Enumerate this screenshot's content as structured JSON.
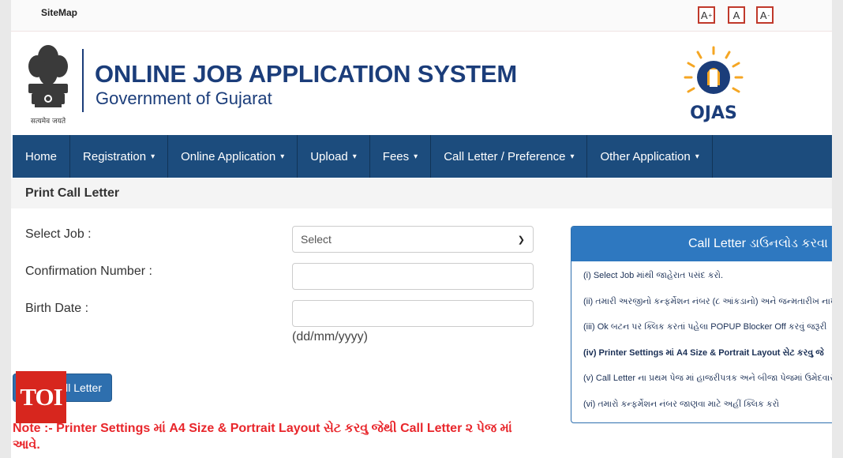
{
  "topbar": {
    "sitemap_label": "SiteMap",
    "font_increase": "A",
    "font_increase_sup": "+",
    "font_normal": "A",
    "font_decrease": "A",
    "font_decrease_sup": "-"
  },
  "header": {
    "title": "ONLINE JOB APPLICATION SYSTEM",
    "subtitle": "Government of Gujarat",
    "emblem_motto": "सत्यमेव जयते",
    "ojas_logo_text": "OJAS"
  },
  "nav": {
    "items": [
      {
        "label": "Home",
        "caret": ""
      },
      {
        "label": "Registration",
        "caret": "▾"
      },
      {
        "label": "Online Application",
        "caret": "▾"
      },
      {
        "label": "Upload",
        "caret": "▾"
      },
      {
        "label": "Fees",
        "caret": "▾"
      },
      {
        "label": "Call Letter / Preference",
        "caret": "▾"
      },
      {
        "label": "Other Application",
        "caret": "▾"
      }
    ]
  },
  "section": {
    "title": "Print Call Letter"
  },
  "form": {
    "job_label": "Select Job :",
    "job_selected": "Select",
    "confirmation_label": "Confirmation Number :",
    "confirmation_value": "",
    "birth_label": "Birth Date :",
    "birth_value": "",
    "date_hint": "(dd/mm/yyyy)",
    "print_button": "ll Letter"
  },
  "badge": {
    "text": "TOI"
  },
  "note": "Note :- Printer Settings માં A4 Size & Portrait Layout સેટ કરવુ જેથી Call Letter ૨ પેજ માં આવે.",
  "instructions": {
    "header": "Call Letter ડાઉનલોડ કરવા",
    "items": [
      "(i) Select Job માંથી જાહેરાત પસંદ કરો.",
      "(ii) તમારી અરજીનો કન્ફર્મેશન નંબર (૮ આંકડાનો) અને જન્મતારીખ નાખ",
      "(iii) Ok બટન પર ક્લિક કરતાં પહેલા POPUP Blocker Off કરવું જરૂરી",
      "(iv) Printer Settings માં A4 Size & Portrait Layout સેટ કરવુ જે",
      "(v) Call Letter ના પ્રથમ પેજ માં હાજરીપત્રક અને બીજા પેજમાં ઉમેદવાર",
      "(vi) તમારો કન્ફર્મેશન નંબર જાણવા માટે અહીં ક્લિક કરો"
    ]
  },
  "colors": {
    "nav_bg": "#1c4c7d",
    "brand_blue": "#1b3d7a",
    "button_blue": "#2e6fae",
    "note_red": "#e8262b",
    "toi_red": "#d7261e"
  }
}
